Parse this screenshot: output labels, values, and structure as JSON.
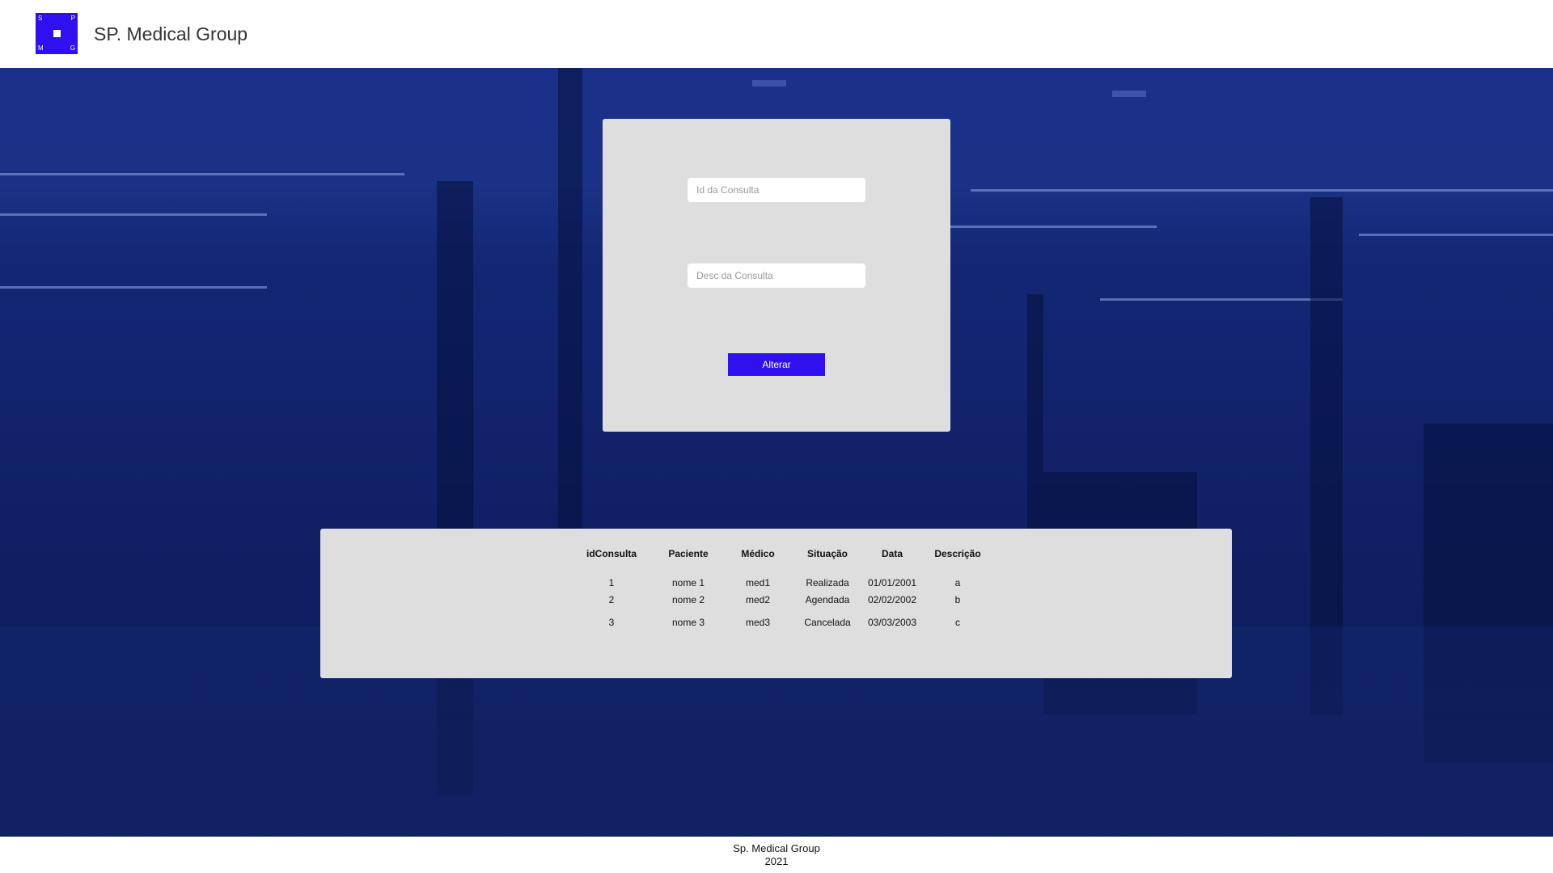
{
  "header": {
    "logo": {
      "letters": [
        "S",
        "P",
        "M",
        "G"
      ]
    },
    "brand": "SP. Medical Group"
  },
  "form": {
    "id_placeholder": "Id da Consulta",
    "desc_placeholder": "Desc da Consulta",
    "submit_label": "Alterar"
  },
  "table": {
    "headers": [
      "idConsulta",
      "Paciente",
      "Médico",
      "Situação",
      "Data",
      "Descrição"
    ],
    "rows": [
      [
        "1",
        "nome 1",
        "med1",
        "Realizada",
        "01/01/2001",
        "a"
      ],
      [
        "2",
        "nome 2",
        "med2",
        "Agendada",
        "02/02/2002",
        "b"
      ],
      [
        "3",
        "nome 3",
        "med3",
        "Cancelada",
        "03/03/2003",
        "c"
      ]
    ]
  },
  "footer": {
    "line1": "Sp. Medical Group",
    "line2": "2021"
  },
  "colors": {
    "accent": "#2f10ee",
    "card": "#dedede",
    "hero": "#132571"
  }
}
